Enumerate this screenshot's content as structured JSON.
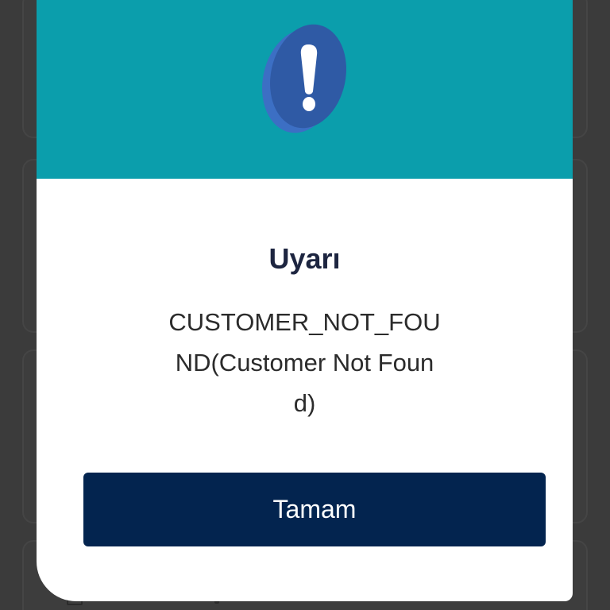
{
  "dialog": {
    "title": "Uyarı",
    "message": "CUSTOMER_NOT_FOUND(Customer Not Found)",
    "ok_label": "Tamam",
    "icon": "exclamation-icon"
  },
  "colors": {
    "header": "#0b9eac",
    "button": "#03244f",
    "title_text": "#1d2540",
    "icon_face": "#2f5aa5",
    "icon_edge": "#3c6fc4",
    "backdrop": "#3b3b3b"
  }
}
